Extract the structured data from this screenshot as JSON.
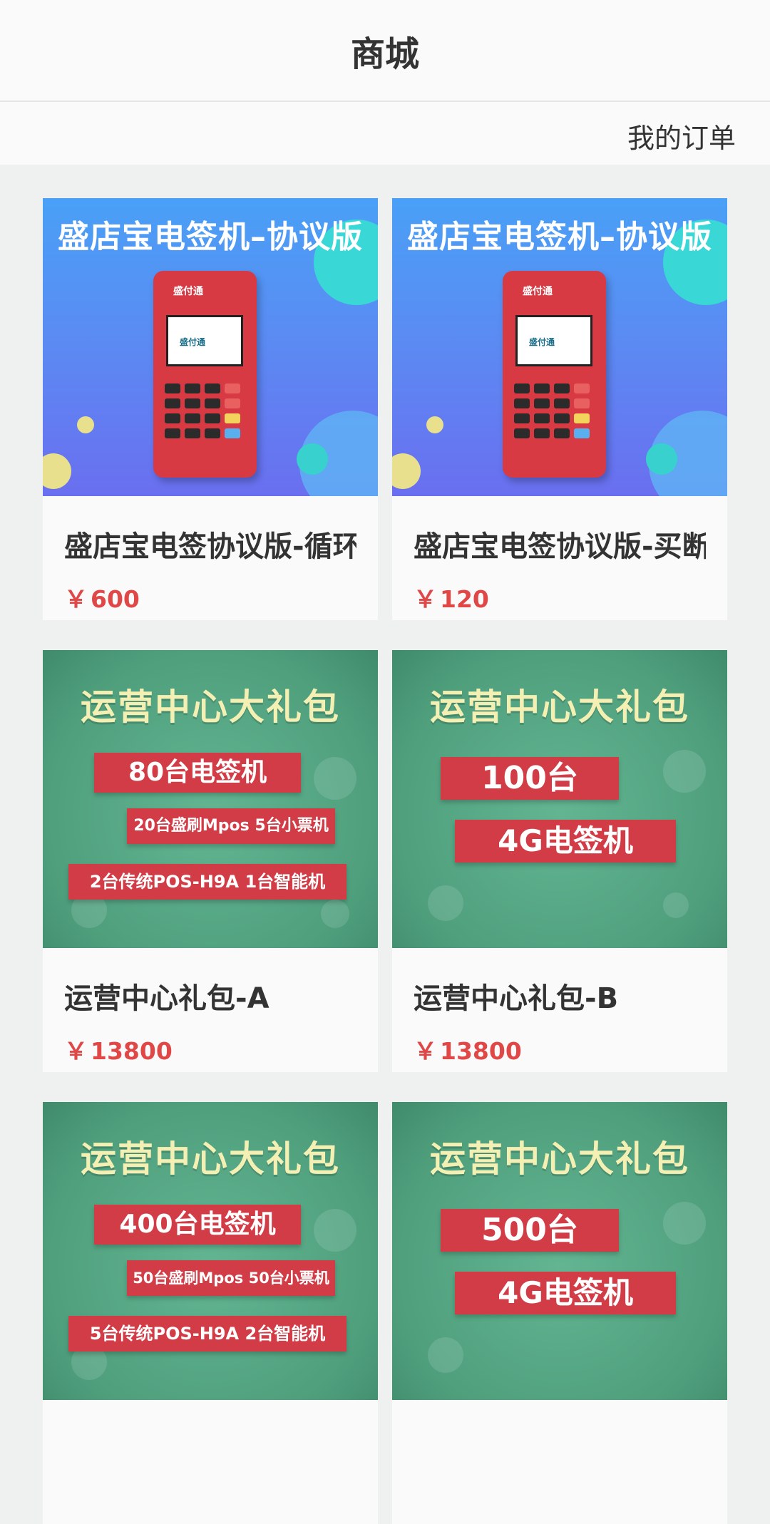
{
  "header": {
    "title": "商城"
  },
  "subbar": {
    "orders_link": "我的订单"
  },
  "colors": {
    "price": "#e04848",
    "background": "#eef1f0"
  },
  "products": [
    {
      "name": "盛店宝电签协议版-循环",
      "currency": "￥",
      "price": "600",
      "poster": {
        "style": "blue",
        "headline": "盛店宝电签机–协议版",
        "brand": "盛付通"
      }
    },
    {
      "name": "盛店宝电签协议版-买断",
      "currency": "￥",
      "price": "120",
      "poster": {
        "style": "blue",
        "headline": "盛店宝电签机–协议版",
        "brand": "盛付通"
      }
    },
    {
      "name": "运营中心礼包-A",
      "currency": "￥",
      "price": "13800",
      "poster": {
        "style": "green",
        "headline": "运营中心大礼包",
        "line1": "80台电签机",
        "line2": "20台盛刷Mpos  5台小票机",
        "line3": "2台传统POS-H9A  1台智能机"
      }
    },
    {
      "name": "运营中心礼包-B",
      "currency": "￥",
      "price": "13800",
      "poster": {
        "style": "green",
        "headline": "运营中心大礼包",
        "line1": "100台",
        "line2": "4G电签机"
      }
    },
    {
      "name": "",
      "currency": "",
      "price": "",
      "poster": {
        "style": "green",
        "headline": "运营中心大礼包",
        "line1": "400台电签机",
        "line2": "50台盛刷Mpos  50台小票机",
        "line3": "5台传统POS-H9A  2台智能机"
      }
    },
    {
      "name": "",
      "currency": "",
      "price": "",
      "poster": {
        "style": "green",
        "headline": "运营中心大礼包",
        "line1": "500台",
        "line2": "4G电签机"
      }
    }
  ]
}
